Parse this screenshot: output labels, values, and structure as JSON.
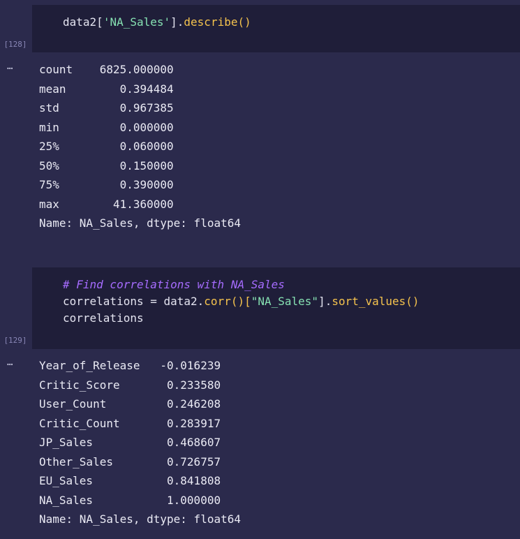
{
  "cells": [
    {
      "exec_count": "[128]",
      "code": {
        "var": "data2",
        "open": "[",
        "str": "'NA_Sales'",
        "close": "].",
        "fn": "describe",
        "parens": "()"
      },
      "output_menu": "…",
      "output": "count    6825.000000\nmean        0.394484\nstd         0.967385\nmin         0.000000\n25%         0.060000\n50%         0.150000\n75%         0.390000\nmax        41.360000\nName: NA_Sales, dtype: float64"
    },
    {
      "exec_count": "[129]",
      "code": {
        "comment": "# Find correlations with NA_Sales",
        "line2_var": "correlations",
        "line2_eq": " = ",
        "line2_obj": "data2.",
        "line2_fn1": "corr",
        "line2_p1": "()[",
        "line2_str": "\"NA_Sales\"",
        "line2_p2": "].",
        "line2_fn2": "sort_values",
        "line2_p3": "()",
        "line3": "correlations"
      },
      "output_menu": "…",
      "output": "Year_of_Release   -0.016239\nCritic_Score       0.233580\nUser_Count         0.246208\nCritic_Count       0.283917\nJP_Sales           0.468607\nOther_Sales        0.726757\nEU_Sales           0.841808\nNA_Sales           1.000000\nName: NA_Sales, dtype: float64"
    }
  ],
  "colors": {
    "background": "#2b2a4c",
    "cell_input": "#1f1e39",
    "string": "#86e1b2",
    "function": "#f5c34d",
    "comment": "#a66cff"
  }
}
